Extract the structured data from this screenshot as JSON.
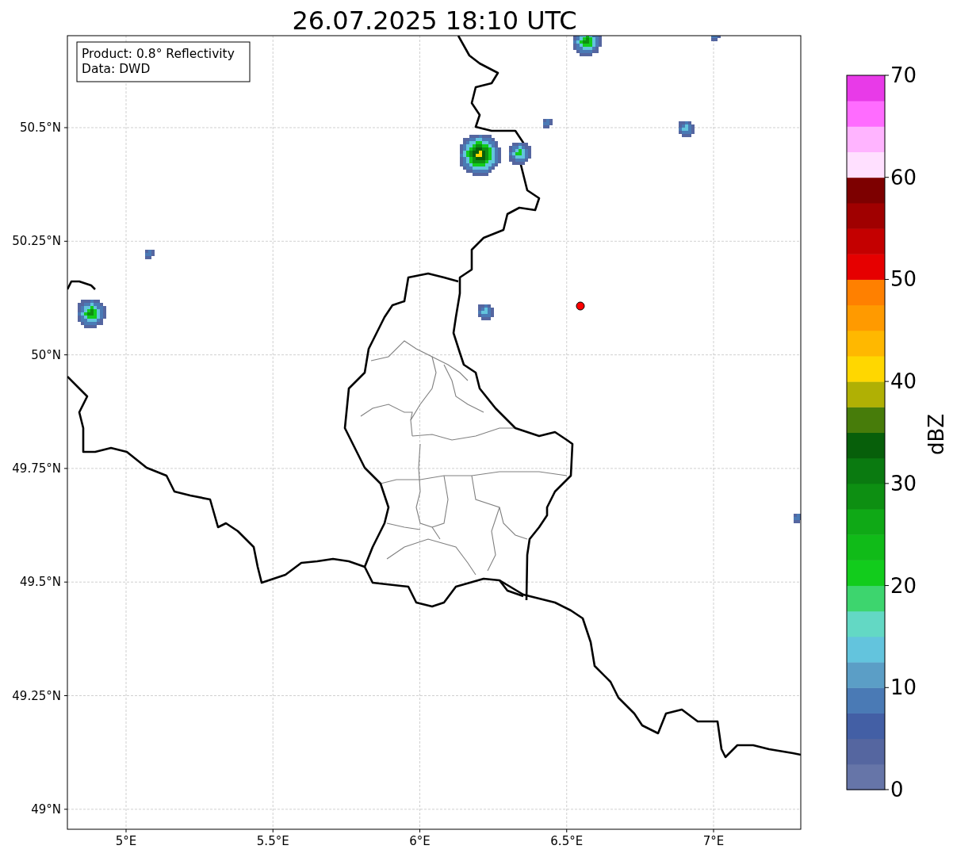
{
  "title": "26.07.2025 18:10 UTC",
  "info_box": {
    "lines": [
      "Product: 0.8° Reflectivity",
      "Data: DWD"
    ]
  },
  "map": {
    "y_labels": [
      "50.5°N",
      "50.25°N",
      "50°N",
      "49.75°N",
      "49.5°N",
      "49.25°N",
      "49°N"
    ],
    "x_labels": [
      "5°E",
      "5.5°E",
      "6°E",
      "6.5°E",
      "7°E"
    ]
  },
  "colorbar": {
    "label": "dBZ",
    "ticks": [
      "70",
      "60",
      "50",
      "40",
      "30",
      "20",
      "10",
      "0"
    ],
    "bands": [
      {
        "color": "#6675a8"
      },
      {
        "color": "#5566a0"
      },
      {
        "color": "#435fa5"
      },
      {
        "color": "#4a7ab5"
      },
      {
        "color": "#5b9ec6"
      },
      {
        "color": "#63c4dd"
      },
      {
        "color": "#63d8c4"
      },
      {
        "color": "#3dd56e"
      },
      {
        "color": "#12cc1c"
      },
      {
        "color": "#10bb18"
      },
      {
        "color": "#0fa916"
      },
      {
        "color": "#0d8f12"
      },
      {
        "color": "#0a7a10"
      },
      {
        "color": "#075f0a"
      },
      {
        "color": "#477c0a"
      },
      {
        "color": "#b0b004"
      },
      {
        "color": "#ffd700"
      },
      {
        "color": "#ffb800"
      },
      {
        "color": "#ff9a00"
      },
      {
        "color": "#ff8000"
      },
      {
        "color": "#e60000"
      },
      {
        "color": "#c40000"
      },
      {
        "color": "#a00000"
      },
      {
        "color": "#7d0000"
      },
      {
        "color": "#ffe0ff"
      },
      {
        "color": "#ffb4ff"
      },
      {
        "color": "#ff6cff"
      },
      {
        "color": "#e83ae8"
      }
    ]
  }
}
